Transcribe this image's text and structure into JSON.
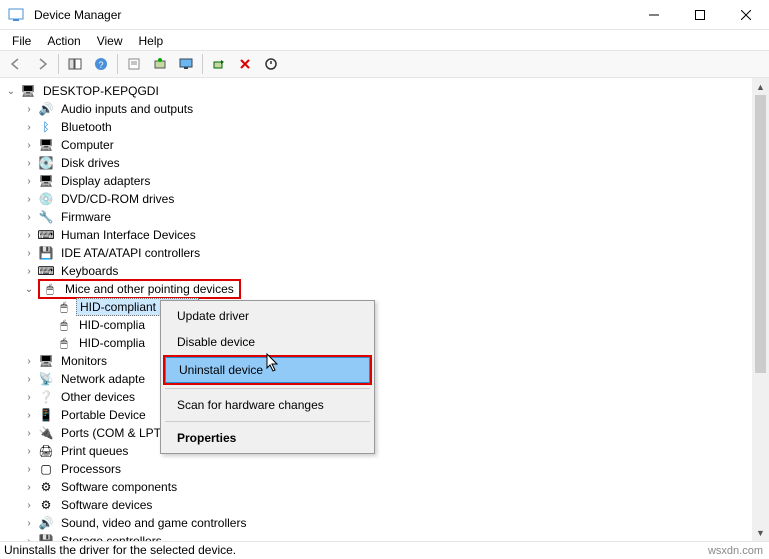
{
  "window": {
    "title": "Device Manager"
  },
  "menus": {
    "file": "File",
    "action": "Action",
    "view": "View",
    "help": "Help"
  },
  "root": {
    "label": "DESKTOP-KEPQGDI"
  },
  "nodes": [
    {
      "label": "Audio inputs and outputs",
      "icon": "🔊"
    },
    {
      "label": "Bluetooth",
      "icon": "ᛒ",
      "color": "#0078d7"
    },
    {
      "label": "Computer",
      "icon": "🖥"
    },
    {
      "label": "Disk drives",
      "icon": "💽"
    },
    {
      "label": "Display adapters",
      "icon": "🖥"
    },
    {
      "label": "DVD/CD-ROM drives",
      "icon": "💿"
    },
    {
      "label": "Firmware",
      "icon": "🔧"
    },
    {
      "label": "Human Interface Devices",
      "icon": "⌨"
    },
    {
      "label": "IDE ATA/ATAPI controllers",
      "icon": "💾"
    },
    {
      "label": "Keyboards",
      "icon": "⌨"
    }
  ],
  "mice": {
    "label": "Mice and other pointing devices",
    "children": [
      {
        "label": "HID-compliant mouse"
      },
      {
        "label": "HID-complia"
      },
      {
        "label": "HID-complia"
      }
    ]
  },
  "below": [
    {
      "label": "Monitors",
      "icon": "🖥"
    },
    {
      "label": "Network adapte",
      "icon": "📡"
    },
    {
      "label": "Other devices",
      "icon": "❔"
    },
    {
      "label": "Portable Device",
      "icon": "📱"
    },
    {
      "label": "Ports (COM & LPT)",
      "icon": "🔌"
    },
    {
      "label": "Print queues",
      "icon": "🖨"
    },
    {
      "label": "Processors",
      "icon": "▢"
    },
    {
      "label": "Software components",
      "icon": "⚙"
    },
    {
      "label": "Software devices",
      "icon": "⚙"
    },
    {
      "label": "Sound, video and game controllers",
      "icon": "🔊"
    },
    {
      "label": "Storage controllers",
      "icon": "💾"
    }
  ],
  "context": {
    "update": "Update driver",
    "disable": "Disable device",
    "uninstall": "Uninstall device",
    "scan": "Scan for hardware changes",
    "properties": "Properties"
  },
  "status": "Uninstalls the driver for the selected device.",
  "watermark": "wsxdn.com"
}
